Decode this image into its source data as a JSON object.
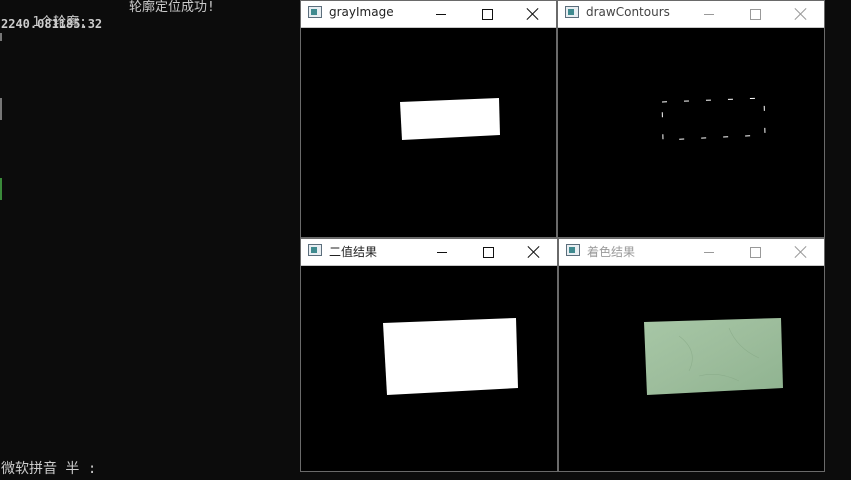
{
  "console": {
    "line1_a": "1个轮廓;",
    "line1_b": "轮廓定位成功!",
    "line2": "2240.081185.32",
    "ime_status": "微软拼音 半 :"
  },
  "windows": {
    "gray": {
      "title": "grayImage",
      "icon": "opencv-window-icon"
    },
    "contours": {
      "title": "drawContours",
      "icon": "opencv-window-icon"
    },
    "binary": {
      "title": "二值结果",
      "icon": "opencv-window-icon"
    },
    "colored": {
      "title": "着色结果",
      "icon": "opencv-window-icon"
    }
  },
  "colors": {
    "console_bg": "#0c0c0c",
    "console_text": "#cccccc",
    "object_fill": "#9fbf9f",
    "shape_white": "#ffffff"
  }
}
